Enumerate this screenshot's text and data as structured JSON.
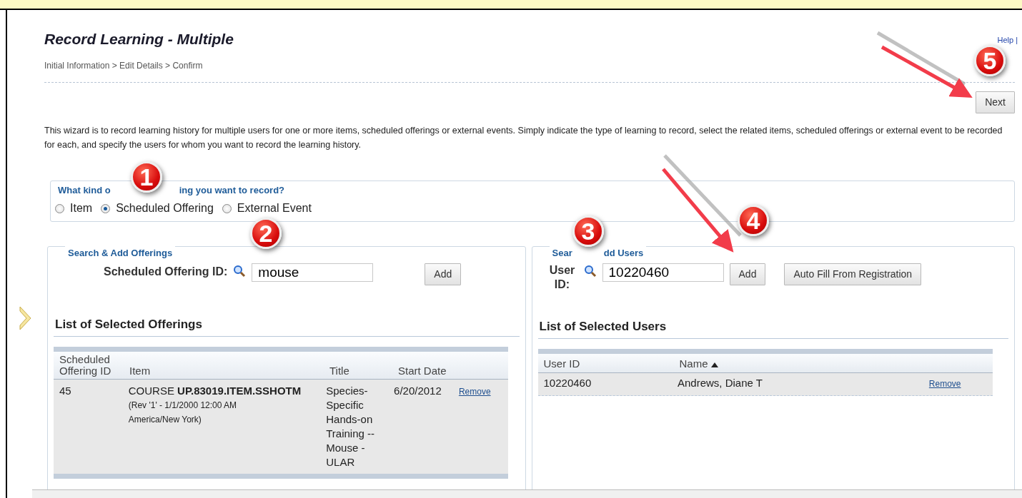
{
  "page": {
    "title": "Record Learning - Multiple",
    "help_link": "Help",
    "help_separator": "|",
    "breadcrumb": "Initial Information > Edit Details > Confirm",
    "next_button": "Next",
    "description": "This wizard is to record learning history for multiple users for one or more items, scheduled offerings or external events. Simply indicate the type of learning to record, select the related items, scheduled offerings or external event to be recorded for each, and specify the users for whom you want to record the learning history."
  },
  "learning_kind": {
    "legend_parts": [
      "What kind o",
      "ing you want to record?"
    ],
    "options": [
      {
        "label": "Item",
        "selected": false
      },
      {
        "label": "Scheduled Offering",
        "selected": true
      },
      {
        "label": "External Event",
        "selected": false
      }
    ]
  },
  "offerings_panel": {
    "legend_parts": [
      "Search & Add Offerings"
    ],
    "field_label": "Scheduled Offering ID:",
    "field_value": "mouse",
    "buttons": [
      "Add"
    ],
    "list_title": "List of Selected Offerings",
    "table": {
      "columns": [
        {
          "label": "Scheduled Offering ID"
        },
        {
          "label": "Item"
        },
        {
          "label": "Title"
        },
        {
          "label": "Start Date"
        }
      ],
      "rows": [
        {
          "cells": [
            "45",
            "COURSE **UP.83019.ITEM.SSHOTM**",
            "Species-Specific Hands-on Training -- Mouse - ULAR",
            "6/20/2012"
          ],
          "item_detail": "(Rev '1' - 1/1/2000 12:00 AM America/New York)",
          "action": "Remove"
        }
      ]
    }
  },
  "users_panel": {
    "legend_parts": [
      "Sear",
      "dd Users"
    ],
    "field_label": "User ID:",
    "field_value": "10220460",
    "buttons": [
      "Add",
      "Auto Fill From Registration"
    ],
    "list_title": "List of Selected Users",
    "table": {
      "columns": [
        {
          "label": "User ID",
          "sorted": false
        },
        {
          "label": "Name",
          "sorted": true
        }
      ],
      "rows": [
        {
          "cells": [
            "10220460",
            "Andrews, Diane T"
          ],
          "action": "Remove"
        }
      ]
    }
  },
  "callouts": [
    {
      "label": "1"
    },
    {
      "label": "2"
    },
    {
      "label": "3"
    },
    {
      "label": "4"
    },
    {
      "label": "5"
    }
  ]
}
